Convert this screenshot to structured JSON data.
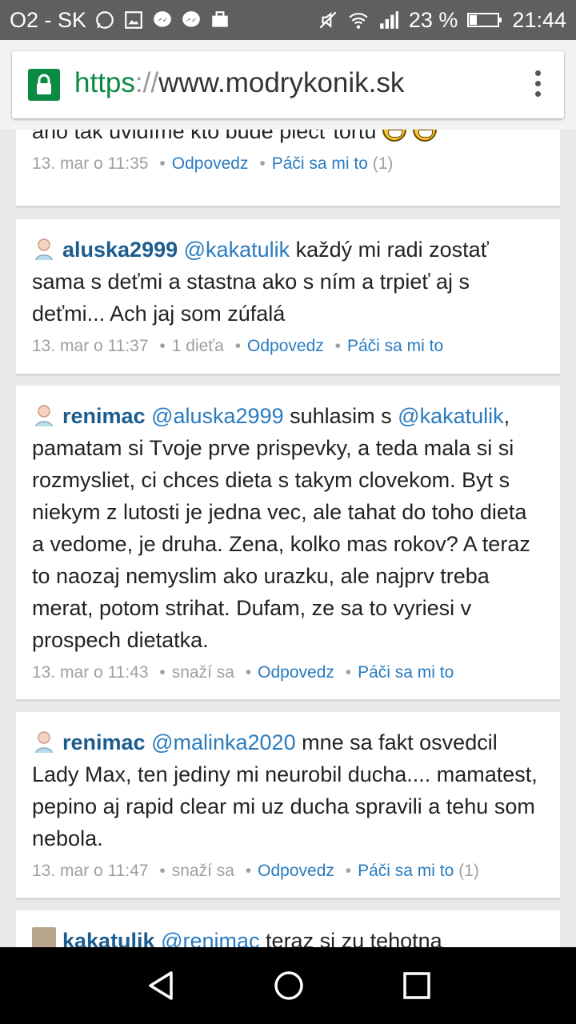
{
  "status_bar": {
    "carrier": "O2 - SK",
    "battery": "23 %",
    "time": "21:44",
    "icons": [
      "whatsapp-icon",
      "gallery-icon",
      "messenger-icon",
      "messenger-icon",
      "briefcase-icon",
      "mute-icon",
      "wifi-icon",
      "signal-icon",
      "battery-icon"
    ]
  },
  "browser": {
    "url_scheme": "https",
    "url_separator": "://",
    "url_host": "www.modrykonik.sk",
    "colors": {
      "secure": "#0b8a43"
    }
  },
  "comments": [
    {
      "text": "áno tak uvidíme kto bude piecť tortu",
      "meta": {
        "time": "13. mar o 11:35",
        "reply": "Odpovedz",
        "like": "Páči sa mi to",
        "like_count": "(1)"
      }
    },
    {
      "author": "aluska2999",
      "mention": "@kakatulik",
      "text": " každý mi radi zostať sama s deťmi a stastna ako s ním a trpieť aj s deťmi... Ach jaj som zúfalá",
      "meta": {
        "time": "13. mar o 11:37",
        "status": "1 dieťa",
        "reply": "Odpovedz",
        "like": "Páči sa mi to"
      }
    },
    {
      "author": "renimac",
      "mention": "@aluska2999",
      "text_mid": " suhlasim s ",
      "mention2": "@kakatulik",
      "text": ", pamatam si Tvoje prve prispevky, a teda mala si si rozmysliet, ci chces dieta s takym clovekom. Byt s niekym z lutosti je jedna vec, ale tahat do toho dieta a vedome, je druha. Zena, kolko mas rokov? A teraz to naozaj nemyslim ako urazku, ale najprv treba merat, potom strihat. Dufam, ze sa to vyriesi v prospech dietatka.",
      "meta": {
        "time": "13. mar o 11:43",
        "status": "snaží sa",
        "reply": "Odpovedz",
        "like": "Páči sa mi to"
      }
    },
    {
      "author": "renimac",
      "mention": "@malinka2020",
      "text": " mne sa fakt osvedcil Lady Max, ten jediny mi neurobil ducha.... mamatest, pepino aj rapid clear mi uz ducha spravili a tehu som nebola.",
      "meta": {
        "time": "13. mar o 11:47",
        "status": "snaží sa",
        "reply": "Odpovedz",
        "like": "Páči sa mi to",
        "like_count": "(1)"
      }
    },
    {
      "author": "kakatulik",
      "mention": "@renimac",
      "text": " teraz si zu tehotna"
    }
  ],
  "meta_separator": "•"
}
